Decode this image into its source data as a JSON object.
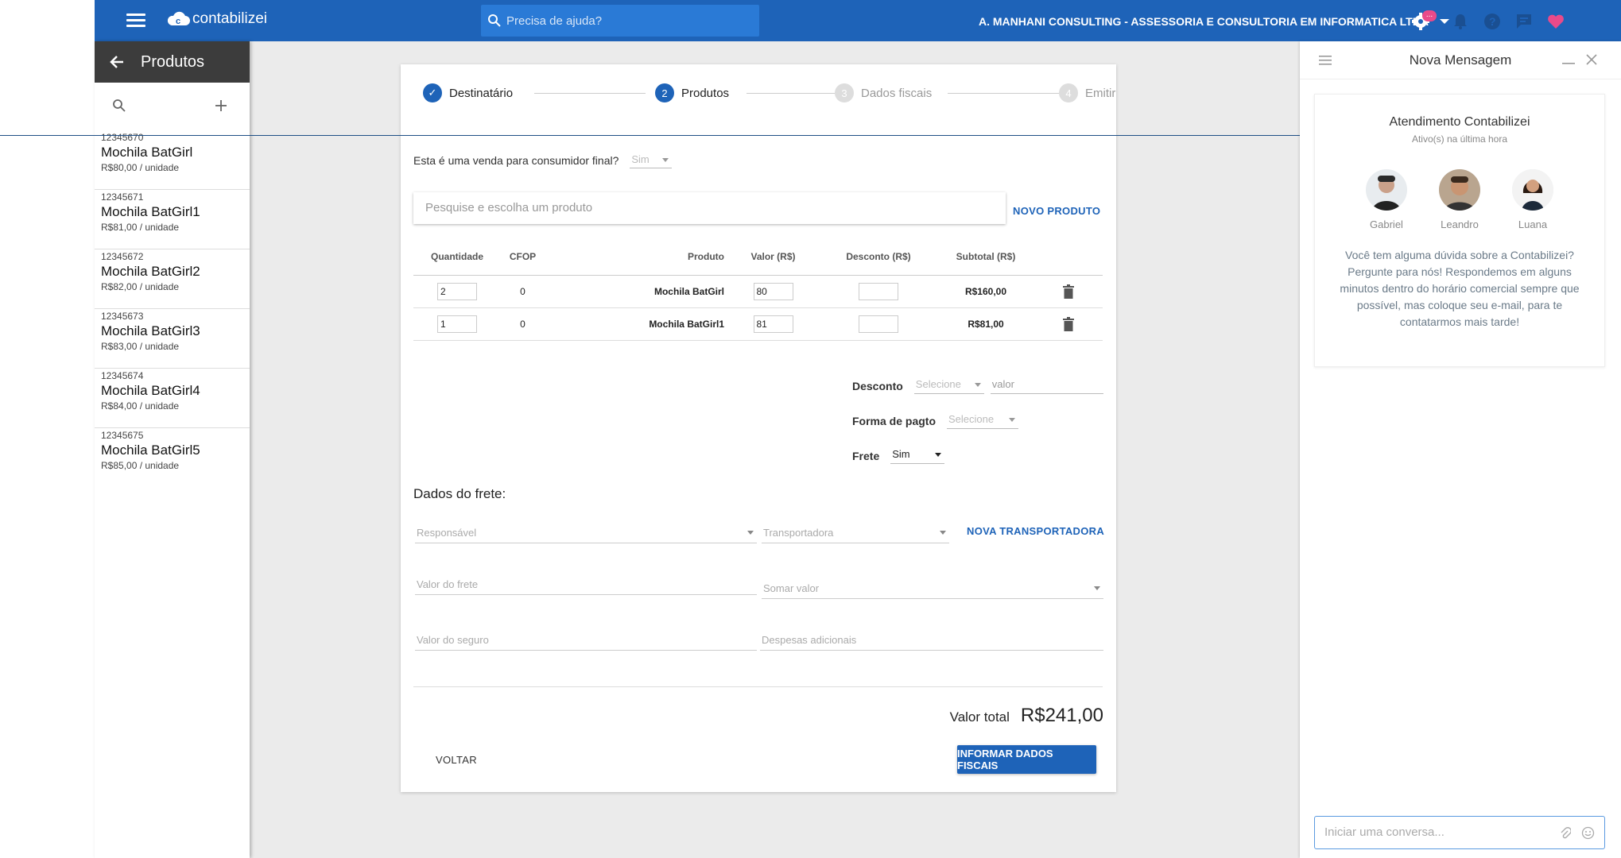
{
  "header": {
    "brand": "contabilizei",
    "search_placeholder": "Precisa de ajuda?",
    "company": "A. MANHANI CONSULTING - ASSESSORIA E CONSULTORIA EM INFORMATICA LTDA",
    "badge": "..."
  },
  "sidebar": {
    "title": "Produtos",
    "items": [
      {
        "code": "12345670",
        "name": "Mochila BatGirl",
        "price": "R$80,00 / unidade"
      },
      {
        "code": "12345671",
        "name": "Mochila BatGirl1",
        "price": "R$81,00 / unidade"
      },
      {
        "code": "12345672",
        "name": "Mochila BatGirl2",
        "price": "R$82,00 / unidade"
      },
      {
        "code": "12345673",
        "name": "Mochila BatGirl3",
        "price": "R$83,00 / unidade"
      },
      {
        "code": "12345674",
        "name": "Mochila BatGirl4",
        "price": "R$84,00 / unidade"
      },
      {
        "code": "12345675",
        "name": "Mochila BatGirl5",
        "price": "R$85,00 / unidade"
      }
    ]
  },
  "stepper": {
    "steps": [
      {
        "num": "✓",
        "label": "Destinatário",
        "state": "done"
      },
      {
        "num": "2",
        "label": "Produtos",
        "state": "active"
      },
      {
        "num": "3",
        "label": "Dados fiscais",
        "state": "pending"
      },
      {
        "num": "4",
        "label": "Emitir",
        "state": "pending"
      }
    ]
  },
  "form": {
    "consumer_question": "Esta é uma venda para consumidor final?",
    "consumer_value": "Sim",
    "product_search_placeholder": "Pesquise e escolha um produto",
    "new_product": "NOVO PRODUTO",
    "table": {
      "headers": [
        "Quantidade",
        "CFOP",
        "Produto",
        "Valor (R$)",
        "Desconto (R$)",
        "Subtotal (R$)"
      ],
      "rows": [
        {
          "qty": "2",
          "cfop": "0",
          "product": "Mochila BatGirl",
          "value": "80",
          "discount": "",
          "subtotal": "R$160,00"
        },
        {
          "qty": "1",
          "cfop": "0",
          "product": "Mochila BatGirl1",
          "value": "81",
          "discount": "",
          "subtotal": "R$81,00"
        }
      ]
    },
    "discount_label": "Desconto",
    "discount_select": "Selecione",
    "discount_value_placeholder": "valor",
    "payment_label": "Forma de pagto",
    "payment_select": "Selecione",
    "freight_label": "Frete",
    "freight_value": "Sim",
    "freight_section_title": "Dados do frete:",
    "responsible_placeholder": "Responsável",
    "carrier_placeholder": "Transportadora",
    "new_carrier": "NOVA TRANSPORTADORA",
    "freight_value_placeholder": "Valor do frete",
    "sum_value_placeholder": "Somar valor",
    "insurance_placeholder": "Valor do seguro",
    "extra_expenses_placeholder": "Despesas adicionais",
    "total_label": "Valor total",
    "total_value": "R$241,00",
    "back_button": "VOLTAR",
    "next_button": "INFORMAR DADOS FISCAIS"
  },
  "chat": {
    "title": "Nova Mensagem",
    "team_name": "Atendimento Contabilizei",
    "status": "Ativo(s) na última hora",
    "agents": [
      "Gabriel",
      "Leandro",
      "Luana"
    ],
    "message": "Você tem alguma dúvida sobre a Contabilizei? Pergunte para nós! Respondemos em alguns minutos dentro do horário comercial sempre que possível, mas coloque seu e-mail, para te contatarmos mais tarde!",
    "input_placeholder": "Iniciar uma conversa..."
  },
  "colors": {
    "primary": "#1e63b8",
    "favorite": "#e94a8a",
    "sidebar_header": "#3c3c3c"
  }
}
